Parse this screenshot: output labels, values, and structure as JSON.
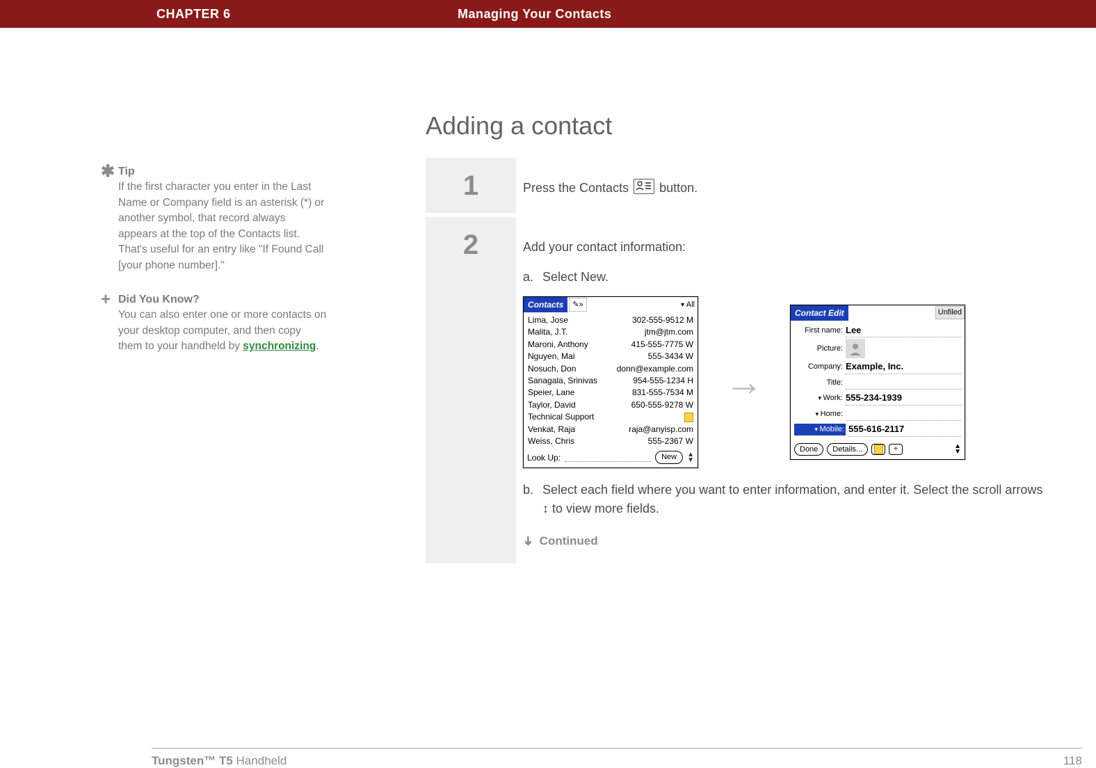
{
  "header": {
    "chapter": "CHAPTER 6",
    "title": "Managing Your Contacts"
  },
  "sidebar": {
    "tip_head": "Tip",
    "tip_body": "If the first character you enter in the Last Name or Company field is an asterisk (*) or another symbol, that record always appears at the top of the Contacts list. That's useful for an entry like \"If Found Call [your phone number].\"",
    "dyk_head": "Did You Know?",
    "dyk_body_a": "You can also enter one or more contacts on your desktop computer, and then copy them to your handheld by ",
    "dyk_link": "synchronizing",
    "dyk_body_b": "."
  },
  "main": {
    "heading": "Adding a contact",
    "step1_text_a": "Press the Contacts ",
    "step1_text_b": " button.",
    "step2_intro": "Add your contact information:",
    "step2_a_letter": "a.",
    "step2_a": "Select New.",
    "step2_b_letter": "b.",
    "step2_b": "Select each field where you want to enter information, and enter it. Select the scroll arrows ↕ to view more fields.",
    "continued": "Continued"
  },
  "palm_list": {
    "title": "Contacts",
    "category": "All",
    "lookup_label": "Look Up:",
    "new_label": "New",
    "rows": [
      {
        "n": "Lima, Jose",
        "v": "302-555-9512 M"
      },
      {
        "n": "Malita, J.T.",
        "v": "jtm@jtm.com"
      },
      {
        "n": "Maroni, Anthony",
        "v": "415-555-7775 W"
      },
      {
        "n": "Nguyen, Mai",
        "v": "555-3434 W"
      },
      {
        "n": "Nosuch, Don",
        "v": "donn@example.com"
      },
      {
        "n": "Sanagala, Srinivas",
        "v": "954-555-1234 H"
      },
      {
        "n": "Speier, Lane",
        "v": "831-555-7534 M"
      },
      {
        "n": "Taylor, David",
        "v": "650-555-9278 W"
      },
      {
        "n": "Technical Support",
        "v": ""
      },
      {
        "n": "Venkat, Raja",
        "v": "raja@anyisp.com"
      },
      {
        "n": "Weiss, Chris",
        "v": "555-2367 W"
      }
    ]
  },
  "palm_edit": {
    "title": "Contact Edit",
    "category": "Unfiled",
    "first_label": "First name:",
    "first_val": "Lee",
    "picture_label": "Picture:",
    "company_label": "Company:",
    "company_val": "Example, Inc.",
    "title_label": "Title:",
    "work_label": "Work:",
    "work_val": "555-234-1939",
    "home_label": "Home:",
    "mobile_label": "Mobile:",
    "mobile_val": "555-616-2117",
    "done": "Done",
    "details": "Details..."
  },
  "footer": {
    "product_a": "Tungsten™ T5",
    "product_b": " Handheld",
    "page": "118"
  }
}
